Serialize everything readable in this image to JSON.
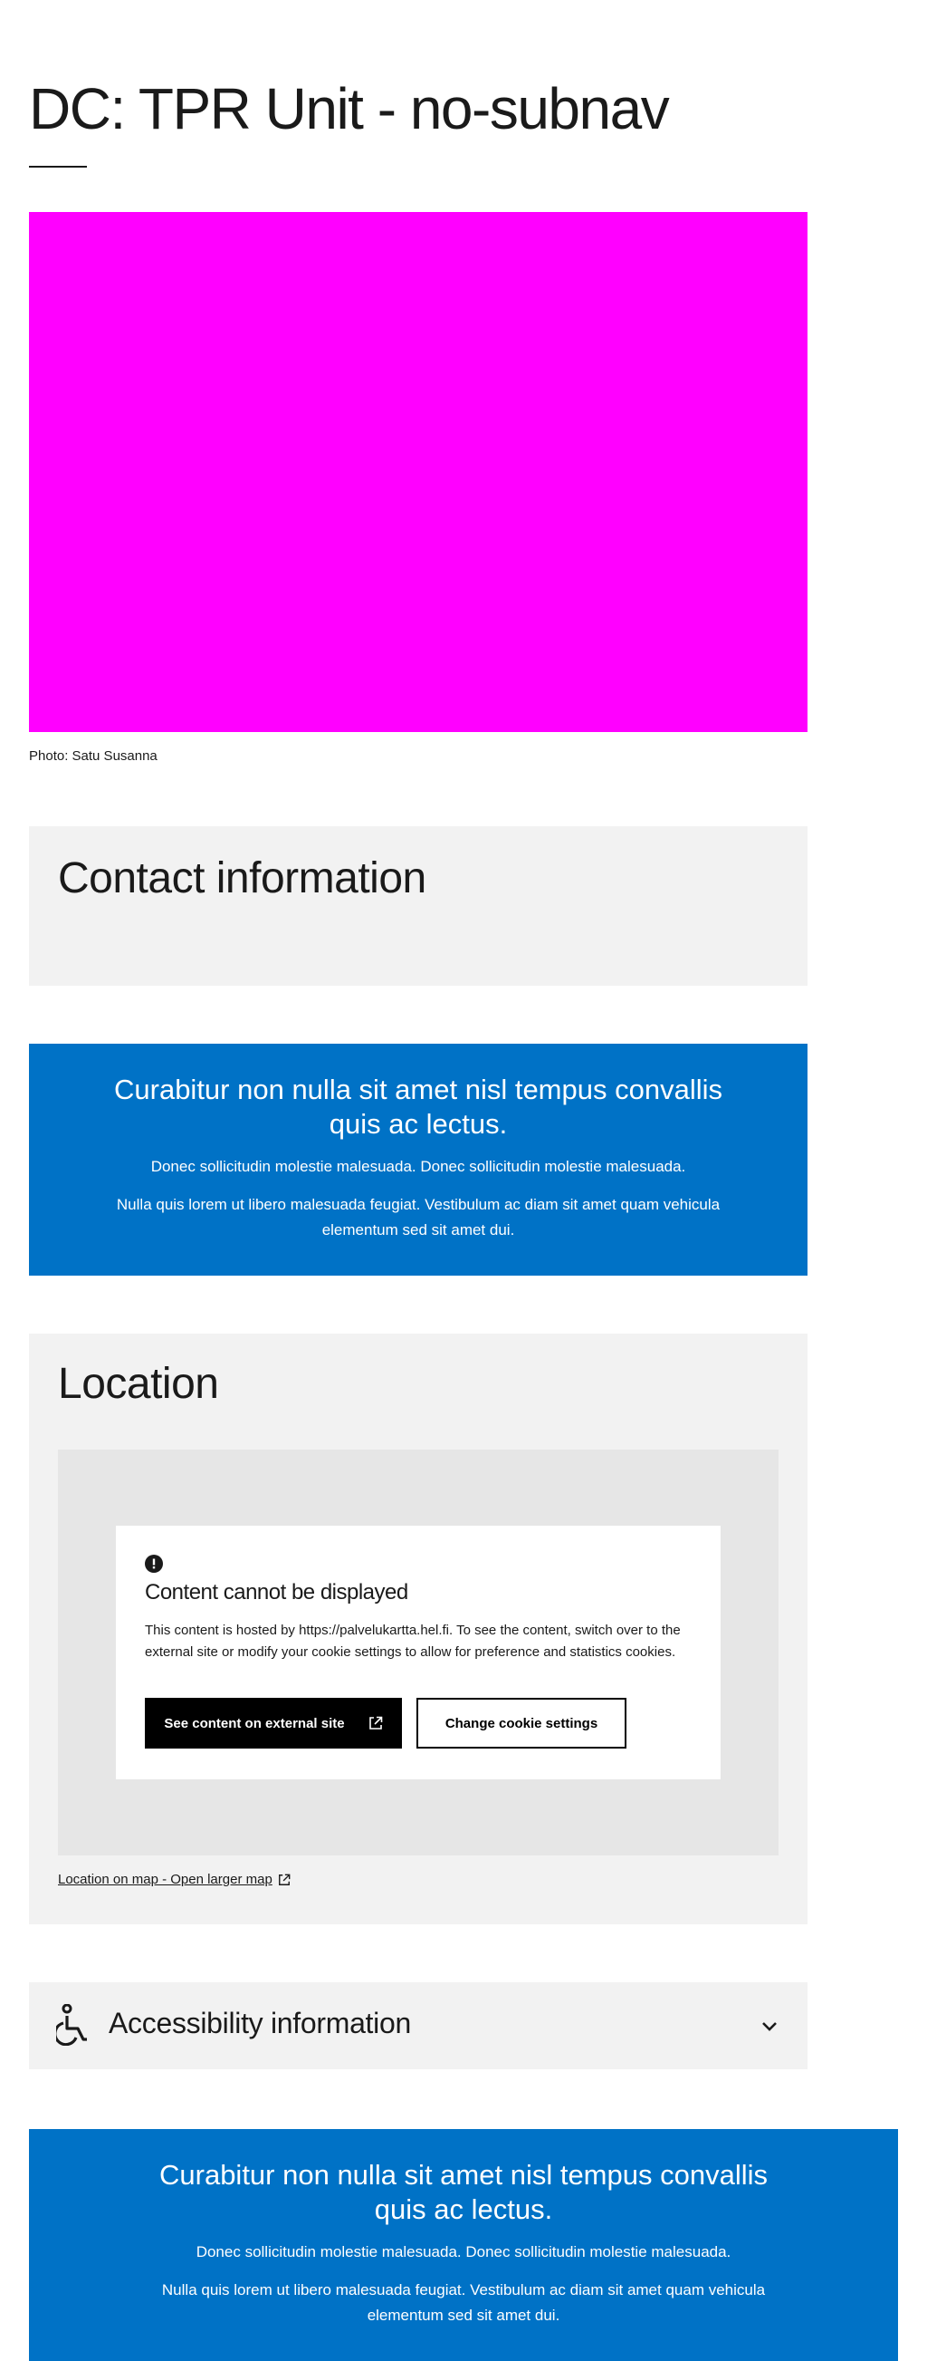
{
  "page": {
    "title": "DC: TPR Unit - no-subnav",
    "image_color": "#ff00ff",
    "photo_caption": "Photo: Satu Susanna"
  },
  "contact": {
    "title": "Contact information"
  },
  "banner_top": {
    "heading": "Curabitur non nulla sit amet nisl tempus convallis quis ac lectus.",
    "text1": "Donec sollicitudin molestie malesuada. Donec sollicitudin molestie malesuada.",
    "text2": "Nulla quis lorem ut libero malesuada feugiat. Vestibulum ac diam sit amet quam vehicula elementum sed sit amet dui.",
    "color": "#0072c6"
  },
  "location": {
    "title": "Location",
    "notice_title": "Content cannot be displayed",
    "notice_text": "This content is hosted by https://palvelukartta.hel.fi. To see the content, switch over to the external site or modify your cookie settings to allow for preference and statistics cookies.",
    "primary_button": "See content on external site",
    "secondary_button": "Change cookie settings",
    "map_link": "Location on map - Open larger map"
  },
  "accessibility": {
    "title": "Accessibility information",
    "icon": "wheelchair-icon",
    "expanded": false
  },
  "banner_bottom": {
    "heading": "Curabitur non nulla sit amet nisl tempus convallis quis ac lectus.",
    "text1": "Donec sollicitudin molestie malesuada. Donec sollicitudin molestie malesuada.",
    "text2": "Nulla quis lorem ut libero malesuada feugiat. Vestibulum ac diam sit amet quam vehicula elementum sed sit amet dui.",
    "color": "#0072c6"
  }
}
